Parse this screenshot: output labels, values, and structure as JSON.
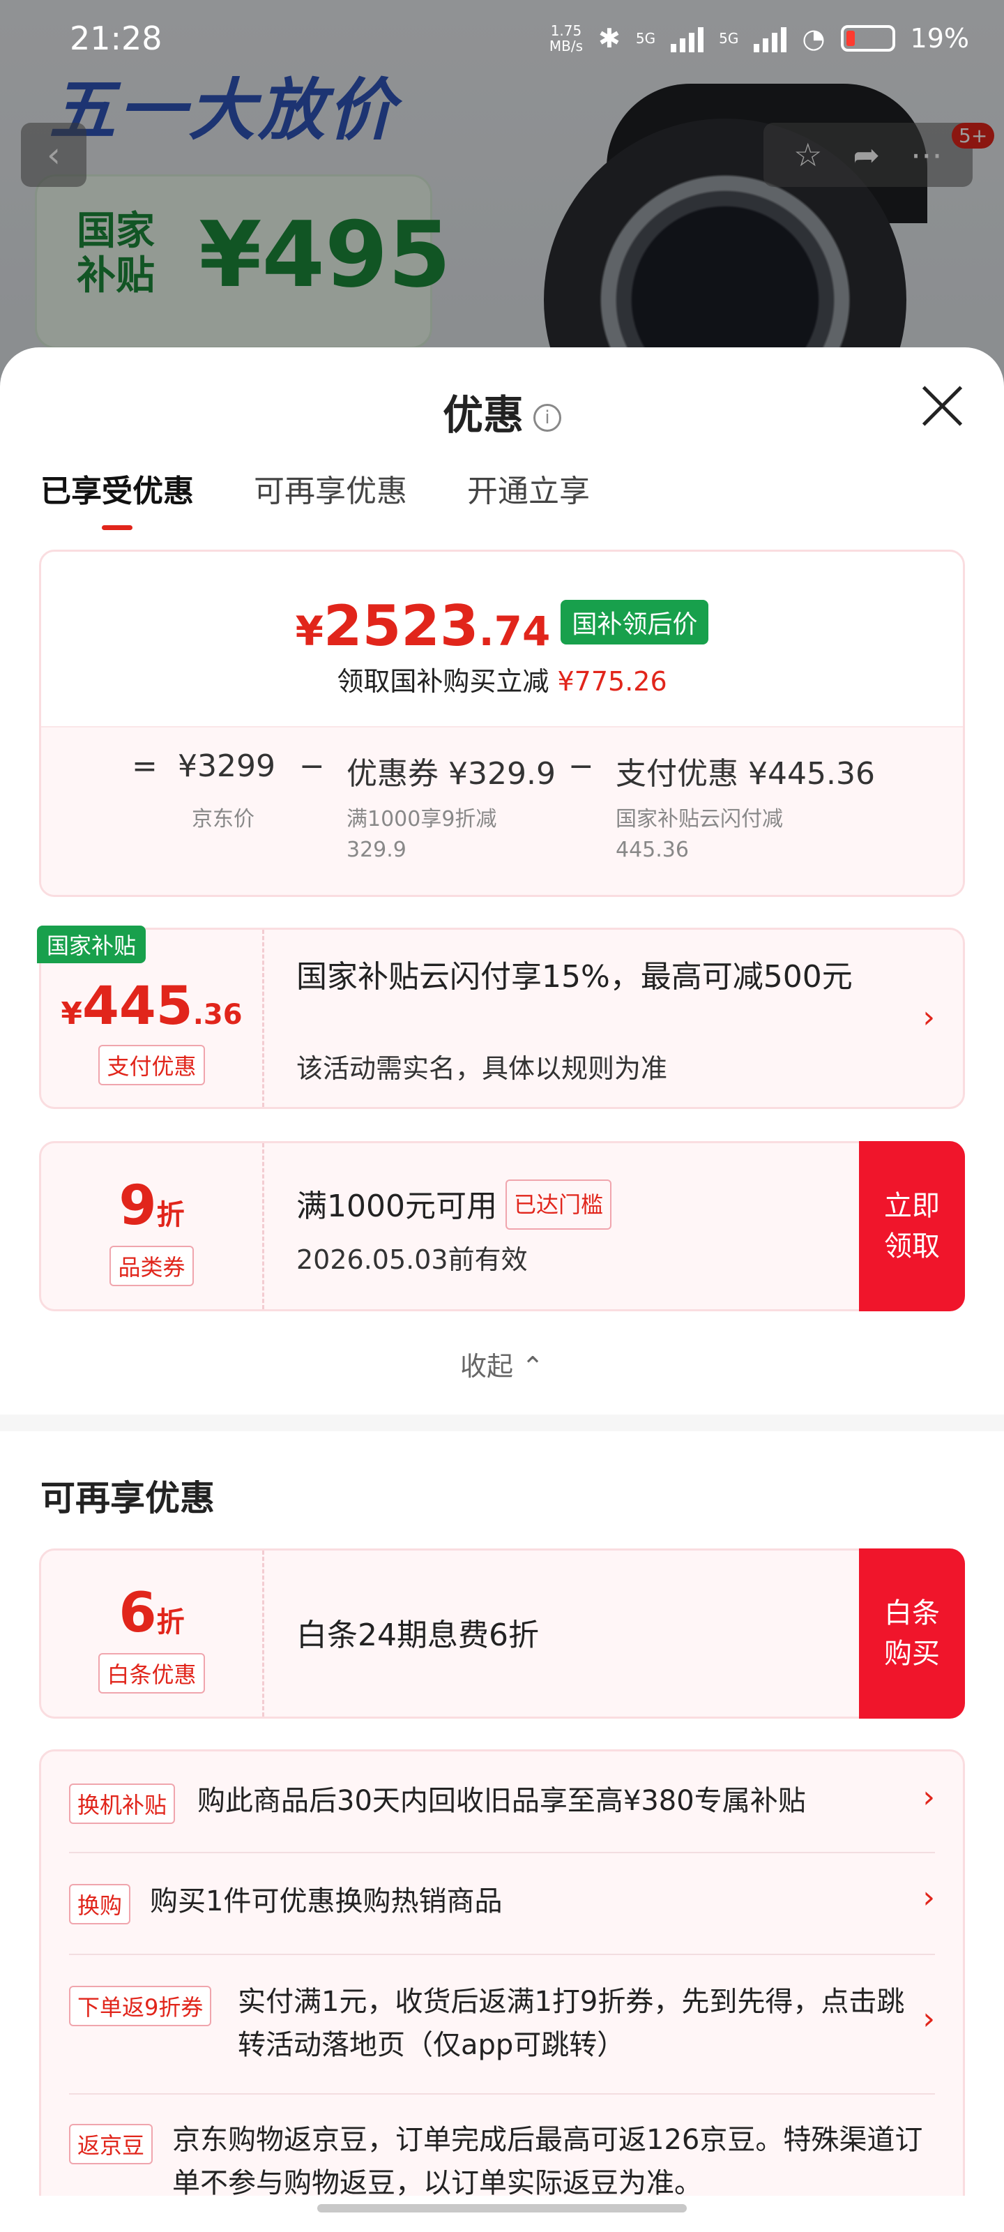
{
  "status_bar": {
    "time": "21:28",
    "net_speed_value": "1.75",
    "net_speed_unit": "MB/s",
    "net_5g_1": "5G",
    "net_5g_2": "5G",
    "wifi_label": "6",
    "battery": "19%"
  },
  "background": {
    "promo_title": "五一大放价",
    "subsidy_label": "国家补贴",
    "subsidy_price": "¥495",
    "badge": "5+"
  },
  "sheet": {
    "title": "优惠",
    "info_icon": "i",
    "tabs": [
      {
        "label": "已享受优惠"
      },
      {
        "label": "可再享优惠"
      },
      {
        "label": "开通立享"
      }
    ]
  },
  "price_card": {
    "yen": "¥",
    "price_int": "2523",
    "price_dec": ".74",
    "price_tag": "国补领后价",
    "subtext": "领取国补购买立减",
    "subtext_amount": "¥775.26",
    "equals": "=",
    "minus": "−",
    "jd_price": "¥3299",
    "jd_price_label": "京东价",
    "coupon": "优惠券 ¥329.9",
    "coupon_sub1": "满1000享9折减",
    "coupon_sub2": "329.9",
    "pay_discount": "支付优惠 ¥445.36",
    "pay_sub1": "国家补贴云闪付减",
    "pay_sub2": "445.36"
  },
  "offers": {
    "subsidy": {
      "badge": "国家补贴",
      "yen": "¥",
      "value_int": "445",
      "value_dec": ".36",
      "chip": "支付优惠",
      "text": "国家补贴云闪付享15%，最高可减500元",
      "sub": "该活动需实名，具体以规则为准"
    },
    "coupon": {
      "value": "9",
      "unit": "折",
      "chip": "品类券",
      "text": "满1000元可用",
      "status_chip": "已达门槛",
      "sub": "2026.05.03前有效",
      "cta": "立即领取"
    },
    "collapse_label": "收起 ⌃"
  },
  "more_section": {
    "title": "可再享优惠",
    "baitiao": {
      "value": "6",
      "unit": "折",
      "chip": "白条优惠",
      "text": "白条24期息费6折",
      "cta": "白条购买"
    },
    "list": [
      {
        "tag": "换机补贴",
        "text": "购此商品后30天内回收旧品享至高¥380专属补贴"
      },
      {
        "tag": "换购",
        "text": "购买1件可优惠换购热销商品"
      },
      {
        "tag": "下单返9折券",
        "text": "实付满1元，收货后返满1打9折券，先到先得，点击跳转活动落地页（仅app可跳转）"
      },
      {
        "tag": "返京豆",
        "text": "京东购物返京豆，订单完成后最高可返126京豆。特殊渠道订单不参与购物返豆，以订单实际返豆为准。"
      }
    ]
  },
  "icons": {
    "back": "back-arrow-icon",
    "favorite": "star-icon",
    "share": "share-icon",
    "more": "more-icon",
    "close": "close-icon",
    "chevron": "chevron-right-icon"
  },
  "colors": {
    "accent_red": "#e1251b",
    "subsidy_green": "#18a04c",
    "cta_red": "#f0152b"
  }
}
